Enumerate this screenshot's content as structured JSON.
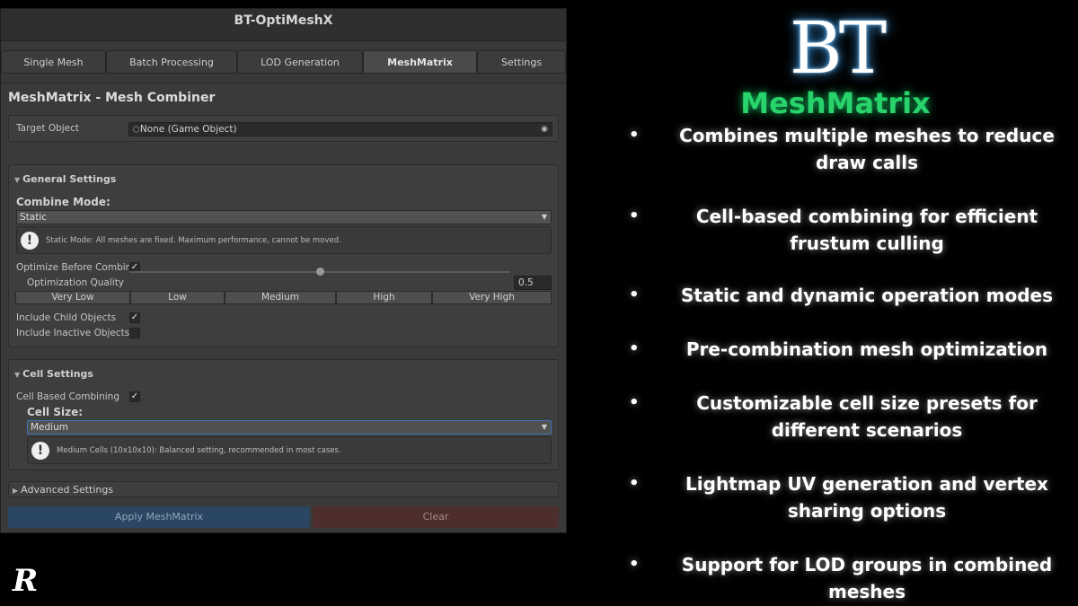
{
  "window": {
    "title": "BT-OptiMeshX"
  },
  "tabs": [
    {
      "label": "Single Mesh"
    },
    {
      "label": "Batch Processing"
    },
    {
      "label": "LOD Generation"
    },
    {
      "label": "MeshMatrix",
      "active": true
    },
    {
      "label": "Settings"
    }
  ],
  "panel": {
    "title": "MeshMatrix - Mesh Combiner",
    "target": {
      "label": "Target Object",
      "value": "None (Game Object)"
    },
    "general": {
      "header": "General Settings",
      "combine_mode_label": "Combine Mode:",
      "combine_mode_value": "Static",
      "combine_help": "Static Mode: All meshes are fixed. Maximum performance, cannot be moved.",
      "optimize_label": "Optimize Before Combinin",
      "optimize_checked": true,
      "quality_label": "Optimization Quality",
      "quality_value": "0.5",
      "quality_presets": [
        "Very Low",
        "Low",
        "Medium",
        "High",
        "Very High"
      ],
      "include_child_label": "Include Child Objects",
      "include_child_checked": true,
      "include_inactive_label": "Include Inactive Objects",
      "include_inactive_checked": false
    },
    "cell": {
      "header": "Cell Settings",
      "cell_based_label": "Cell Based Combining",
      "cell_based_checked": true,
      "cell_size_label": "Cell Size:",
      "cell_size_value": "Medium",
      "cell_help": "Medium Cells (10x10x10): Balanced setting, recommended in most cases."
    },
    "advanced": {
      "header": "Advanced Settings"
    },
    "apply_label": "Apply MeshMatrix",
    "clear_label": "Clear"
  },
  "promo": {
    "logo": "BT",
    "brand": "MeshMatrix",
    "brand_color": "#27d36a",
    "bullet": "•",
    "features": [
      "Combines multiple meshes to reduce draw calls",
      "Cell-based combining for efficient frustum culling",
      "Static and dynamic operation modes",
      "Pre-combination mesh optimization",
      "Customizable cell size presets for different scenarios",
      "Lightmap UV generation and vertex sharing options",
      "Support for LOD groups in combined meshes"
    ]
  },
  "corner_logo": "R",
  "icons": {
    "check": "✓",
    "fold_open": "▼",
    "fold_closed": "▶",
    "dropdown": "▼",
    "help": "!",
    "object_picker": "◉",
    "gameobject": "⬡"
  }
}
